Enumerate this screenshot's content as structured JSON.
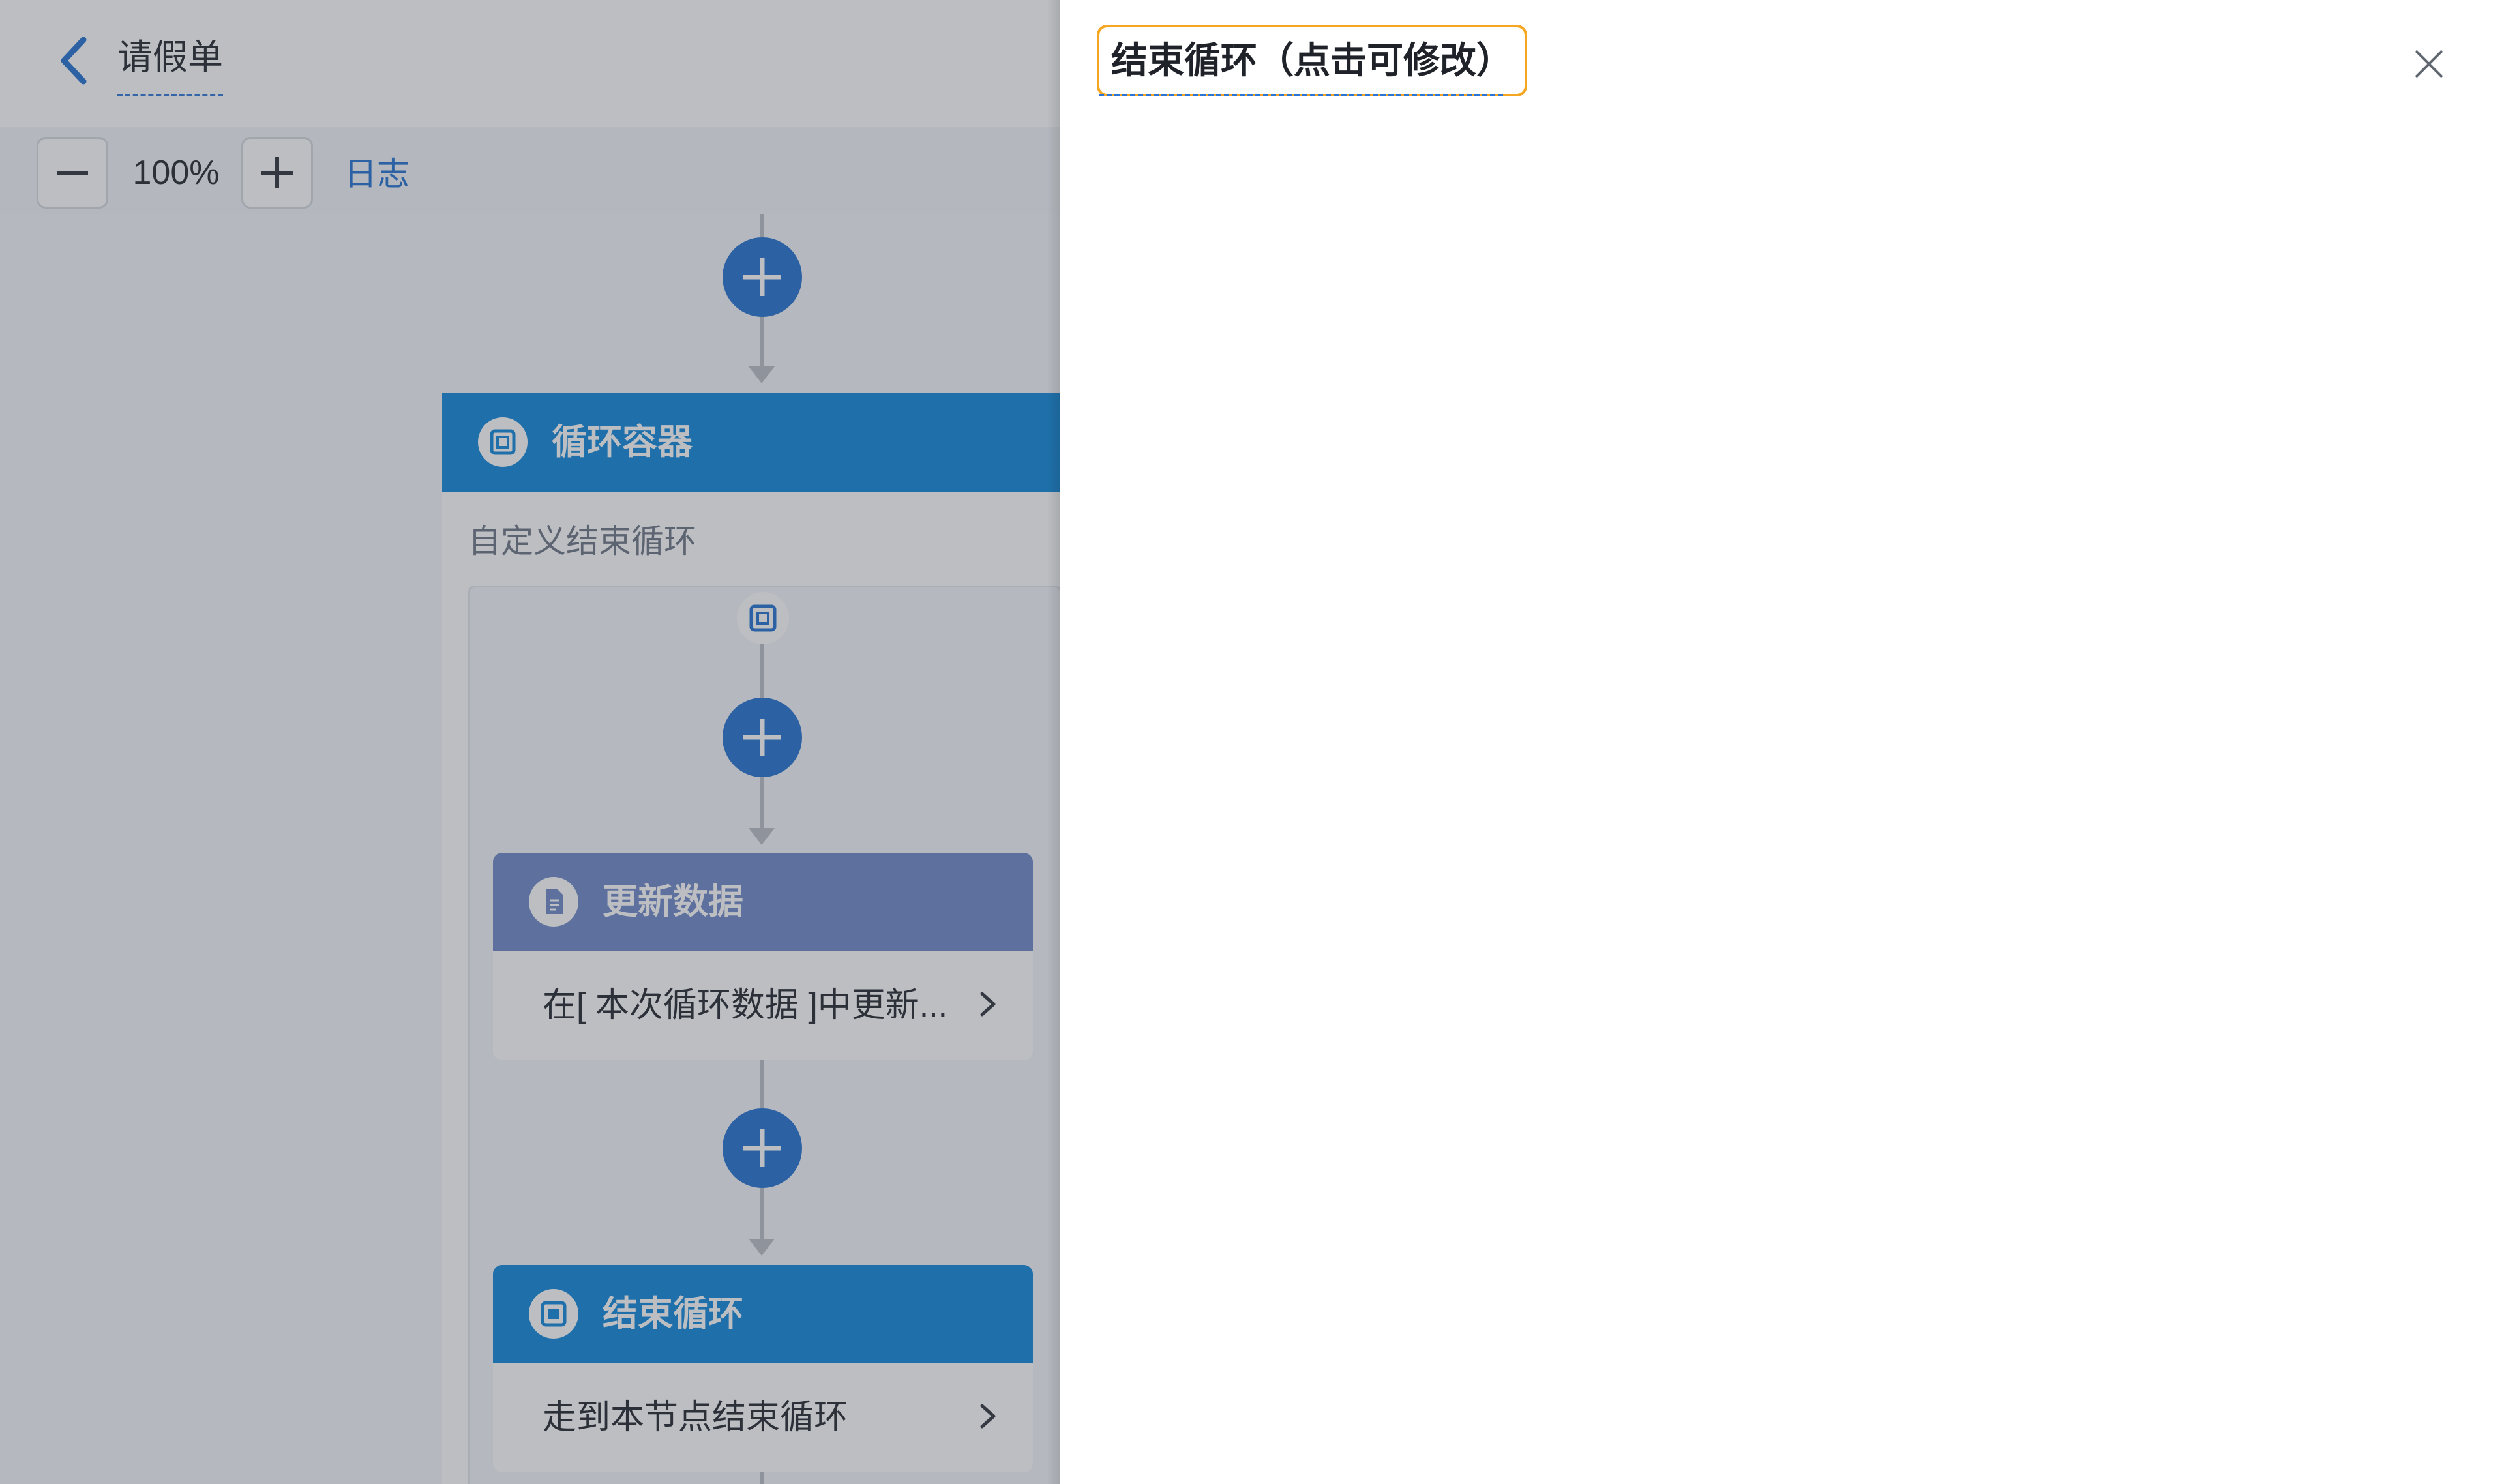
{
  "header": {
    "title": "请假单"
  },
  "toolbar": {
    "zoom_level": "100%",
    "log_label": "日志"
  },
  "flow": {
    "loop_container": {
      "title": "循环容器",
      "subtitle": "自定义结束循环"
    },
    "update_node": {
      "title": "更新数据",
      "description": "在[ 本次循环数据 ]中更新..."
    },
    "end_loop_node": {
      "title": "结束循环",
      "description": "走到本节点结束循环"
    }
  },
  "drawer": {
    "title": "结束循环（点击可修改）"
  },
  "colors": {
    "primary_blue": "#1f6fd1",
    "loop_header_blue": "#0a86d9",
    "update_header": "#6b85c7",
    "title_highlight": "#f5a623"
  },
  "icons": [
    "chevron-left-icon",
    "minus-icon",
    "plus-icon",
    "loop-icon",
    "document-icon",
    "stop-icon",
    "chevron-right-icon",
    "close-icon"
  ]
}
